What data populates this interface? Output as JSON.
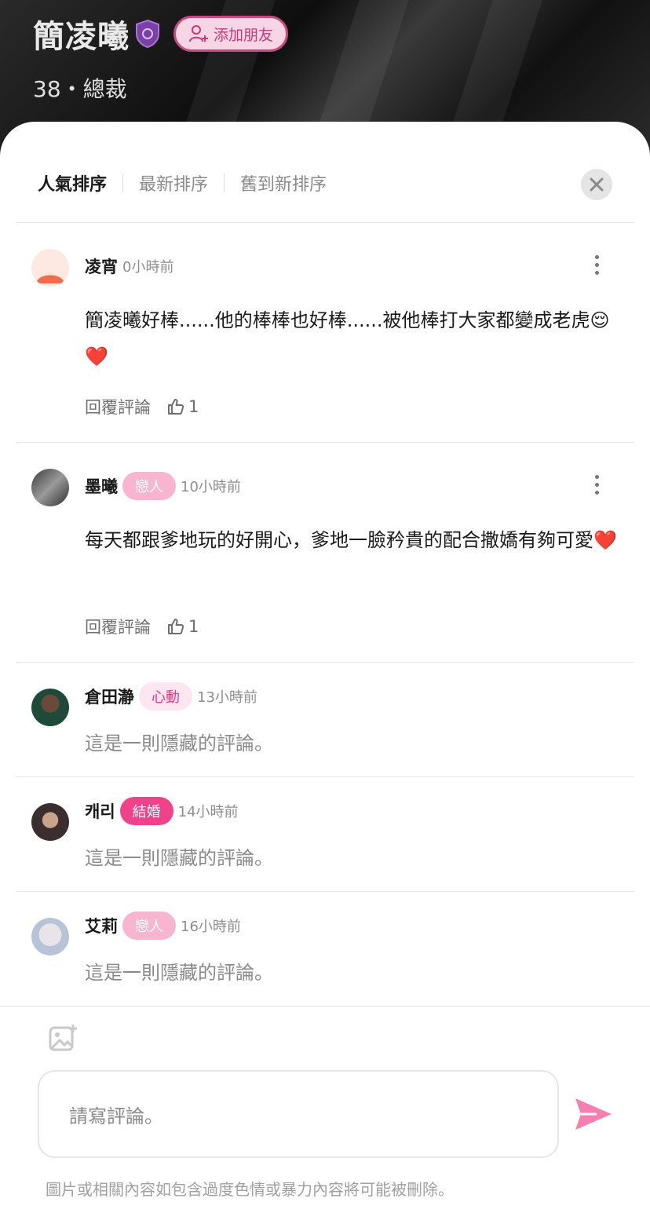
{
  "header": {
    "name": "簡凌曦",
    "add_friend": "添加朋友",
    "subtitle": "38・總裁"
  },
  "sort_tabs": [
    "人氣排序",
    "最新排序",
    "舊到新排序"
  ],
  "comments": [
    {
      "author": "凌宵",
      "time": "0小時前",
      "body": "簡凌曦好棒......他的棒棒也好棒......被他棒打大家都變成老虎😌❤️",
      "reply": "回覆評論",
      "likes": "1"
    },
    {
      "author": "墨曦",
      "tag": "戀人",
      "time": "10小時前",
      "body": "每天都跟爹地玩的好開心，爹地一臉矜貴的配合撒嬌有夠可愛❤️",
      "reply": "回覆評論",
      "likes": "1"
    },
    {
      "author": "倉田瀞",
      "tag": "心動",
      "time": "13小時前",
      "hidden": "這是一則隱藏的評論。"
    },
    {
      "author": "캐리",
      "tag": "結婚",
      "time": "14小時前",
      "hidden": "這是一則隱藏的評論。"
    },
    {
      "author": "艾莉",
      "tag": "戀人",
      "time": "16小時前",
      "hidden": "這是一則隱藏的評論。"
    }
  ],
  "composer": {
    "placeholder": "請寫評論。",
    "notice": "圖片或相關內容如包含過度色情或暴力內容將可能被刪除。"
  },
  "colors": {
    "accent_pink": "#f0428a",
    "lover_tag": "#f9b4cf",
    "send_icon": "#f57fb0"
  },
  "icons": [
    "shield-badge-icon",
    "add-user-icon",
    "close-icon",
    "more-vertical-icon",
    "thumbs-up-icon",
    "add-image-icon",
    "send-icon"
  ]
}
